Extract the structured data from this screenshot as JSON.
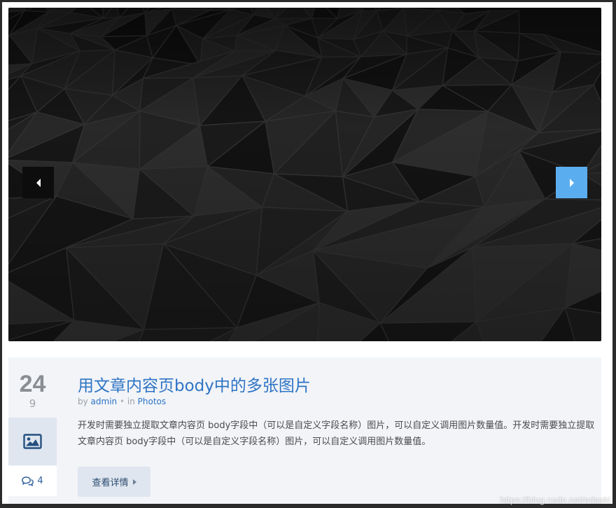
{
  "slider": {
    "image_icon": "dark-polygon-background",
    "prev_icon": "triangle-left-icon",
    "next_icon": "triangle-right-icon",
    "next_color": "#5aaef0"
  },
  "post": {
    "day": "24",
    "month": "9",
    "type_icon": "picture-icon",
    "comment_icon": "comments-icon",
    "comment_count": "4",
    "title": "用文章内容页body中的多张图片",
    "meta": {
      "by_label": "by",
      "author": "admin",
      "separator": "•",
      "in_label": "in",
      "category": "Photos"
    },
    "excerpt": "开发时需要独立提取文章内容页 body字段中（可以是自定义字段名称）图片，可以自定义调用图片数量值。开发时需要独立提取文章内容页 body字段中（可以是自定义字段名称）图片，可以自定义调用图片数量值。",
    "more_label": "查看详情",
    "more_icon": "caret-right-icon"
  },
  "watermark": "https://blog.csdn.net/edsoki",
  "colors": {
    "accent": "#2e74c4",
    "panel": "#f2f4f8",
    "button_bg": "#dfe6ef"
  }
}
